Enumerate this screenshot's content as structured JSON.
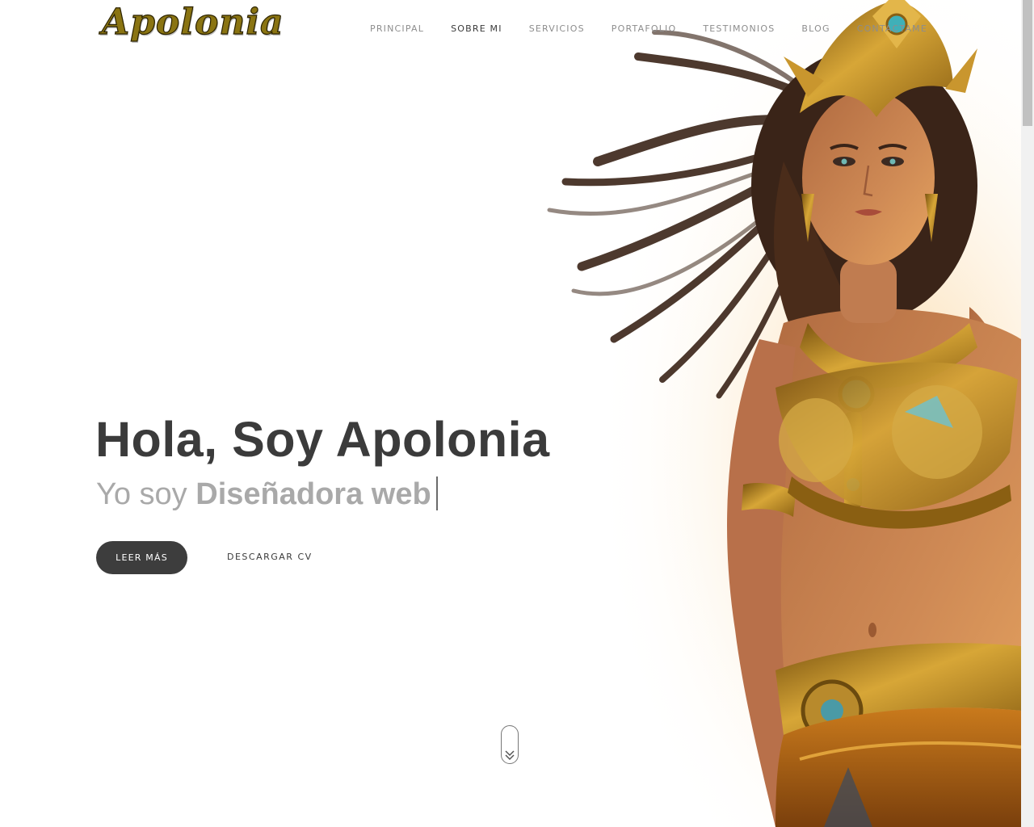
{
  "brand": {
    "logo_text": "Apolonia"
  },
  "nav": {
    "items": [
      {
        "label": "PRINCIPAL",
        "active": false
      },
      {
        "label": "SOBRE MI",
        "active": true
      },
      {
        "label": "SERVICIOS",
        "active": false
      },
      {
        "label": "PORTAFOLIO",
        "active": false
      },
      {
        "label": "TESTIMONIOS",
        "active": false
      },
      {
        "label": "BLOG",
        "active": false
      },
      {
        "label": "CONTACTAME",
        "active": false
      }
    ]
  },
  "hero": {
    "title": "Hola, Soy Apolonia",
    "subtitle_prefix": "Yo soy",
    "subtitle_role": "Diseñadora web",
    "primary_button": "LEER MÁS",
    "secondary_button": "DESCARGAR CV"
  },
  "icons": {
    "scroll_down": "double-chevron-down-icon"
  },
  "colors": {
    "text_dark": "#3d3d3d",
    "text_muted": "#a9a9a9",
    "nav_inactive": "#8d8d8d",
    "nav_active": "#3a3a3a",
    "button_bg": "#3d3d3d",
    "gold": "#c8961e",
    "skin": "#c98458",
    "hair": "#3a2418"
  }
}
